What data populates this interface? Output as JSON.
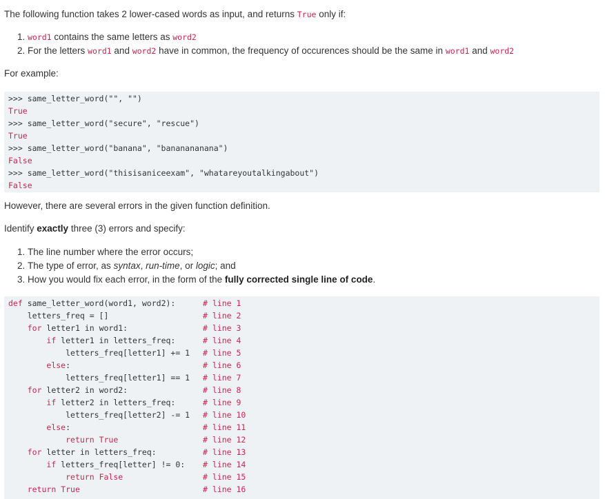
{
  "intro": {
    "prefix": "The following function takes 2 lower-cased words as input, and returns",
    "true_code": "True",
    "suffix": "only if:"
  },
  "conditions": [
    {
      "t1": "",
      "c1": "word1",
      "t2": " contains the same letters as ",
      "c2": "word2",
      "t3": ""
    },
    {
      "t1": "For the letters ",
      "c1": "word1",
      "t2": " and ",
      "c2": "word2",
      "t3": " have in common, the frequency of occurences should be the same in ",
      "c3": "word1",
      "t4": " and ",
      "c4": "word2"
    }
  ],
  "for_example": "For example:",
  "examples": [
    {
      "call": ">>> same_letter_word(\"\", \"\")",
      "result": "True"
    },
    {
      "call": ">>> same_letter_word(\"secure\", \"rescue\")",
      "result": "True"
    },
    {
      "call": ">>> same_letter_word(\"banana\", \"bananananana\")",
      "result": "False"
    },
    {
      "call": ">>> same_letter_word(\"thisisaniceexam\", \"whatareyoutalkingabout\")",
      "result": "False"
    }
  ],
  "however": "However, there are several errors in the given function definition.",
  "identify": {
    "prefix": "Identify ",
    "bold": "exactly",
    "suffix": " three (3) errors and specify:"
  },
  "steps": {
    "s1": "The line number where the error occurs;",
    "s2_a": "The type of error, as ",
    "s2_syntax": "syntax",
    "s2_b": ", ",
    "s2_runtime": "run-time",
    "s2_c": ", or ",
    "s2_logic": "logic",
    "s2_d": "; and",
    "s3_a": "How you would fix each error, in the form of the ",
    "s3_bold": "fully corrected single line of code",
    "s3_b": "."
  },
  "code_lines": [
    {
      "indent": "",
      "kw": "def",
      "text": " same_letter_word(word1, word2):",
      "comment": "# line 1"
    },
    {
      "indent": "    ",
      "kw": "",
      "text": "letters_freq = []",
      "comment": "# line 2"
    },
    {
      "indent": "    ",
      "kw": "for",
      "text": " letter1 in word1:",
      "comment": "# line 3"
    },
    {
      "indent": "        ",
      "kw": "if",
      "text": " letter1 in letters_freq:",
      "comment": "# line 4"
    },
    {
      "indent": "            ",
      "kw": "",
      "text": "letters_freq[letter1] += 1",
      "comment": "# line 5"
    },
    {
      "indent": "        ",
      "kw": "else",
      "text": ":",
      "comment": "# line 6"
    },
    {
      "indent": "            ",
      "kw": "",
      "text": "letters_freq[letter1] == 1",
      "comment": "# line 7"
    },
    {
      "indent": "    ",
      "kw": "for",
      "text": " letter2 in word2:",
      "comment": "# line 8"
    },
    {
      "indent": "        ",
      "kw": "if",
      "text": " letter2 in letters_freq:",
      "comment": "# line 9"
    },
    {
      "indent": "            ",
      "kw": "",
      "text": "letters_freq[letter2] -= 1",
      "comment": "# line 10"
    },
    {
      "indent": "        ",
      "kw": "else",
      "text": ":",
      "comment": "# line 11"
    },
    {
      "indent": "            ",
      "kw": "return",
      "text": " True",
      "comment": "# line 12"
    },
    {
      "indent": "    ",
      "kw": "for",
      "text": " letter in letters_freq:",
      "comment": "# line 13"
    },
    {
      "indent": "        ",
      "kw": "if",
      "text": " letters_freq[letter] != 0:",
      "comment": "# line 14"
    },
    {
      "indent": "            ",
      "kw": "return",
      "text": " False",
      "comment": "# line 15"
    },
    {
      "indent": "    ",
      "kw": "return",
      "text": " True",
      "comment": "# line 16"
    }
  ]
}
